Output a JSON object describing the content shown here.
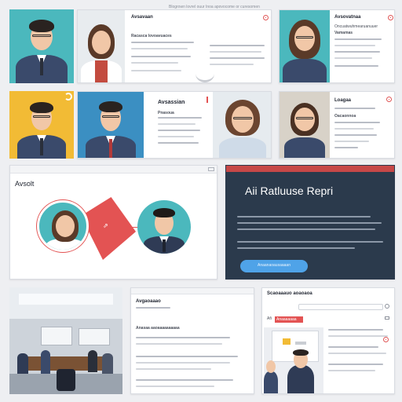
{
  "top_caption": "Blogrown lovrel ouur Inoa apovocome or curesomen",
  "card1": {
    "title": "Avsavaan",
    "subtitle": "Racasca lovoavuaces"
  },
  "card2": {
    "title": "Avsovatnaa",
    "subtitle": "Vamamas",
    "line1": "Oncuatwuhmearuanuuer"
  },
  "card3": {
    "title": "Avsassian",
    "subtitle": "Pnasoua"
  },
  "card4": {
    "title": "Loagaa",
    "subtitle": "Oacaonnoa"
  },
  "card5": {
    "title": "Avsolt"
  },
  "report": {
    "title": "Aii Ratluuse Repri",
    "button_label": "Anaanaoausaaaan",
    "bg_color": "#2b3a4c",
    "accent_color": "#4fa3e8"
  },
  "card7": {
    "title": "Avgaoaaao",
    "heading": "Anasaa aaoaaaaaaaaaa"
  },
  "card8": {
    "title": "Scaoaaauo aoaoaoa",
    "tab": "Afi",
    "tab_label": "Anaaaaaaa"
  },
  "colors": {
    "teal": "#4bb8bd",
    "yellow": "#f2bb35",
    "accent_red": "#e35353",
    "navy_suit": "#3a4a6b"
  }
}
